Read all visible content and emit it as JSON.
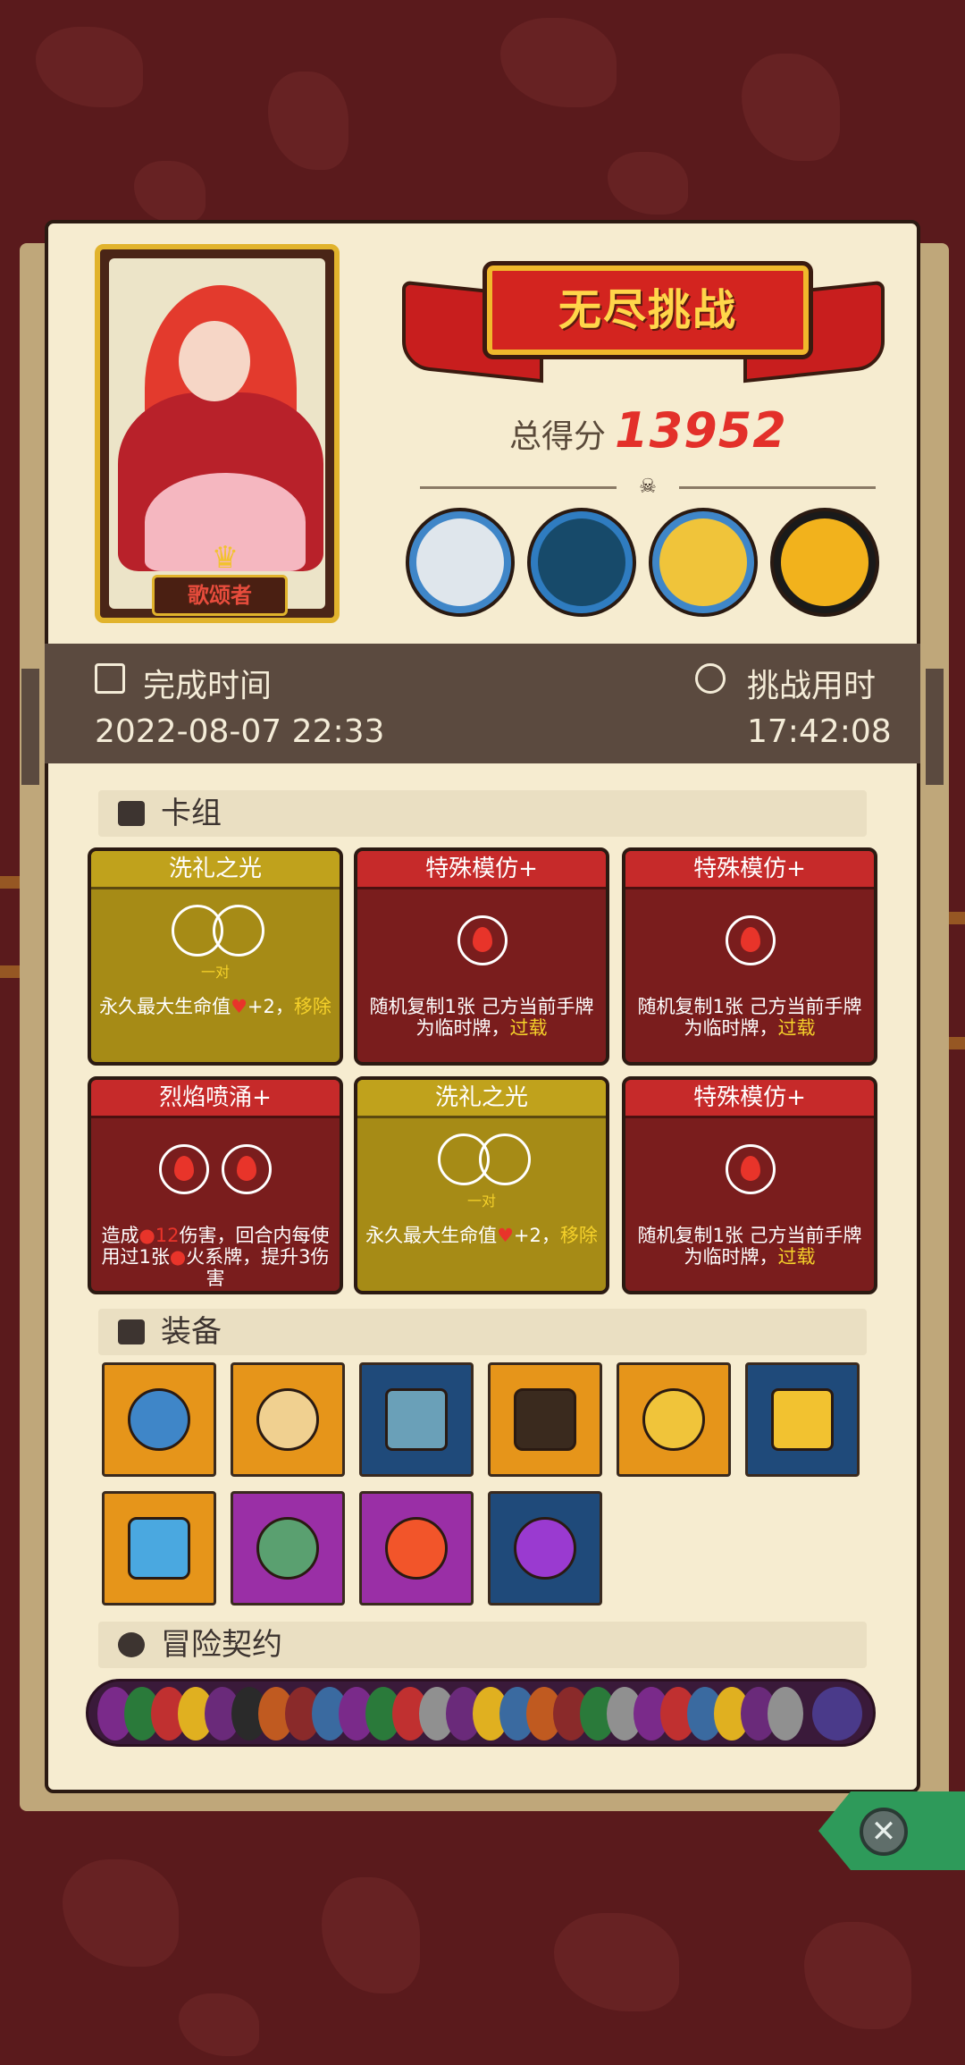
{
  "banner": {
    "title": "无尽挑战"
  },
  "score": {
    "label": "总得分",
    "value": "13952"
  },
  "hero": {
    "name": "歌颂者"
  },
  "completion": {
    "label": "完成时间",
    "value": "2022-08-07 22:33"
  },
  "duration": {
    "label": "挑战用时",
    "value": "17:42:08"
  },
  "sections": {
    "deck": "卡组",
    "equipment": "装备",
    "contracts": "冒险契约"
  },
  "cards": [
    {
      "title": "洗礼之光",
      "pair": "一对",
      "desc": "永久最大生命值",
      "plus": "+2，",
      "hl": "移除"
    },
    {
      "title": "特殊模仿+",
      "desc": "随机复制1张 己方当前手牌 为临时牌，",
      "hl": "过载"
    },
    {
      "title": "特殊模仿+",
      "desc": "随机复制1张 己方当前手牌 为临时牌，",
      "hl": "过载"
    },
    {
      "title": "烈焰喷涌+",
      "desc_a": "造成",
      "dmg": "12",
      "desc_b": "伤害，回合内每使用过1张",
      "desc_c": "火系牌，提升3伤害"
    },
    {
      "title": "洗礼之光",
      "pair": "一对",
      "desc": "永久最大生命值",
      "plus": "+2，",
      "hl": "移除"
    },
    {
      "title": "特殊模仿+",
      "desc": "随机复制1张 己方当前手牌 为临时牌，",
      "hl": "过载"
    }
  ],
  "colors": {
    "accent_red": "#e3302a",
    "card_gold": "#a68b16",
    "card_red": "#7a1d1d",
    "highlight": "#f5d12a"
  }
}
